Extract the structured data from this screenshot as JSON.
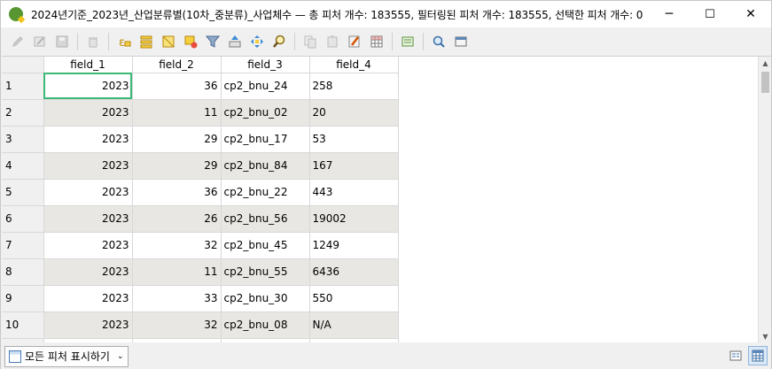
{
  "window": {
    "title": "2024년기준_2023년_산업분류별(10차_중분류)_사업체수 — 총 피처 개수: 183555, 필터링된 피처 개수: 183555, 선택한 피처 개수: 0",
    "minimize": "─",
    "maximize": "☐",
    "close": "✕"
  },
  "toolbar": {
    "icons": [
      "pencil-icon",
      "toggle-multi-edit-icon",
      "save-icon",
      "add-feature-icon",
      "delete-icon",
      "expression-select-icon",
      "select-all-icon",
      "invert-selection-icon",
      "deselect-icon",
      "filter-icon",
      "move-selection-top-icon",
      "pan-map-icon",
      "zoom-map-icon",
      "copy-icon",
      "paste-icon",
      "new-field-icon",
      "delete-field-icon",
      "field-calculator-icon",
      "conditional-format-icon",
      "actions-icon",
      "dock-icon"
    ]
  },
  "table": {
    "columns": [
      "field_1",
      "field_2",
      "field_3",
      "field_4"
    ],
    "rows": [
      {
        "n": "1",
        "f1": "2023",
        "f2": "36",
        "f3": "cp2_bnu_24",
        "f4": "258"
      },
      {
        "n": "2",
        "f1": "2023",
        "f2": "11",
        "f3": "cp2_bnu_02",
        "f4": "20"
      },
      {
        "n": "3",
        "f1": "2023",
        "f2": "29",
        "f3": "cp2_bnu_17",
        "f4": "53"
      },
      {
        "n": "4",
        "f1": "2023",
        "f2": "29",
        "f3": "cp2_bnu_84",
        "f4": "167"
      },
      {
        "n": "5",
        "f1": "2023",
        "f2": "36",
        "f3": "cp2_bnu_22",
        "f4": "443"
      },
      {
        "n": "6",
        "f1": "2023",
        "f2": "26",
        "f3": "cp2_bnu_56",
        "f4": "19002"
      },
      {
        "n": "7",
        "f1": "2023",
        "f2": "32",
        "f3": "cp2_bnu_45",
        "f4": "1249"
      },
      {
        "n": "8",
        "f1": "2023",
        "f2": "11",
        "f3": "cp2_bnu_55",
        "f4": "6436"
      },
      {
        "n": "9",
        "f1": "2023",
        "f2": "33",
        "f3": "cp2_bnu_30",
        "f4": "550"
      },
      {
        "n": "10",
        "f1": "2023",
        "f2": "32",
        "f3": "cp2_bnu_08",
        "f4": "N/A"
      }
    ]
  },
  "statusbar": {
    "filter_label": "모든 피처 표시하기",
    "caret": "⌄"
  },
  "colors": {
    "alt_row": "#e9e7e3",
    "selected_outline": "#3cb878",
    "qgis_green": "#589632"
  }
}
